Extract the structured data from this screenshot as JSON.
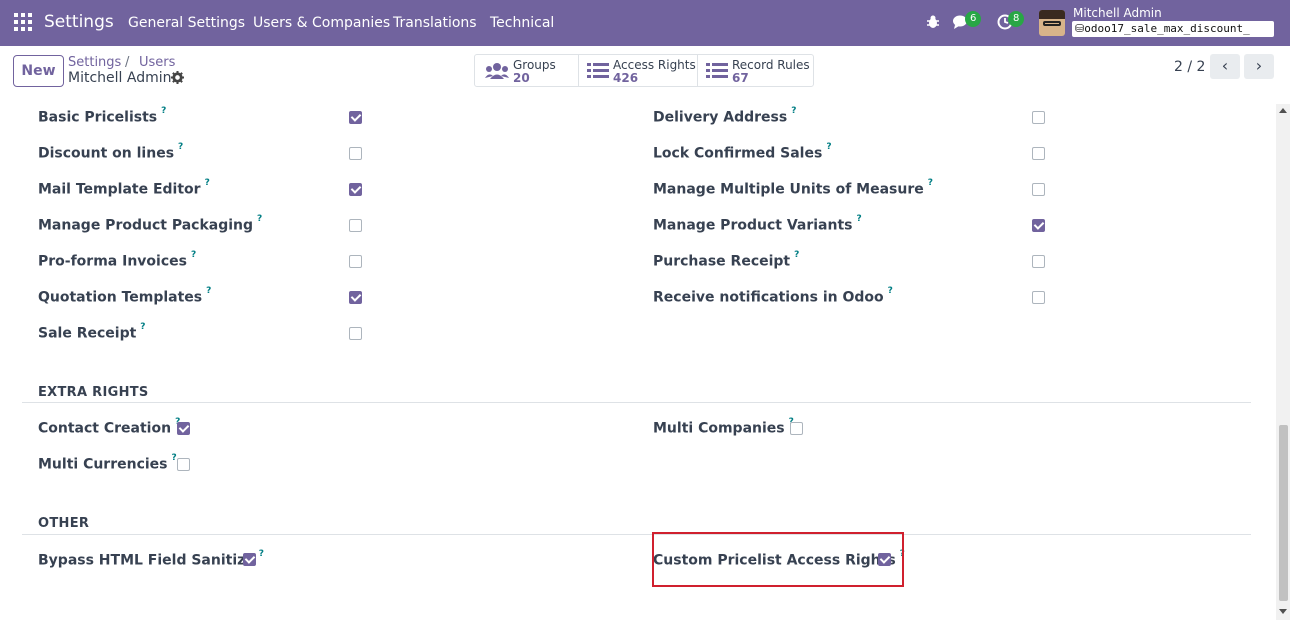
{
  "navbar": {
    "brand": "Settings",
    "menus": [
      "General Settings",
      "Users & Companies",
      "Translations",
      "Technical"
    ],
    "messages_count": "6",
    "activities_count": "8",
    "user_name": "Mitchell Admin",
    "database": "odoo17_sale_max_discount_"
  },
  "control": {
    "new_label": "New",
    "breadcrumb_settings": "Settings",
    "breadcrumb_sep": "/",
    "breadcrumb_users": "Users",
    "current_record": "Mitchell Admin",
    "stats": [
      {
        "label": "Groups",
        "count": "20"
      },
      {
        "label": "Access Rights",
        "count": "426"
      },
      {
        "label": "Record Rules",
        "count": "67"
      }
    ],
    "pager": "2 / 2",
    "prev": "‹",
    "next": "›"
  },
  "sales_rights": {
    "left": [
      {
        "label": "Basic Pricelists",
        "checked": true
      },
      {
        "label": "Discount on lines",
        "checked": false
      },
      {
        "label": "Mail Template Editor",
        "checked": true
      },
      {
        "label": "Manage Product Packaging",
        "checked": false
      },
      {
        "label": "Pro-forma Invoices",
        "checked": false
      },
      {
        "label": "Quotation Templates",
        "checked": true
      },
      {
        "label": "Sale Receipt",
        "checked": false
      }
    ],
    "right": [
      {
        "label": "Delivery Address",
        "checked": false
      },
      {
        "label": "Lock Confirmed Sales",
        "checked": false
      },
      {
        "label": "Manage Multiple Units of Measure",
        "checked": false
      },
      {
        "label": "Manage Product Variants",
        "checked": true
      },
      {
        "label": "Purchase Receipt",
        "checked": false
      },
      {
        "label": "Receive notifications in Odoo",
        "checked": false
      }
    ]
  },
  "extra_rights": {
    "title": "EXTRA RIGHTS",
    "contact_creation": {
      "label": "Contact Creation",
      "checked": true
    },
    "multi_currencies": {
      "label": "Multi Currencies",
      "checked": false
    },
    "multi_companies": {
      "label": "Multi Companies",
      "checked": false
    }
  },
  "other": {
    "title": "OTHER",
    "bypass_html": {
      "label": "Bypass HTML Field Sanitize",
      "checked": true
    },
    "custom_pricelist": {
      "label": "Custom Pricelist Access Rights",
      "checked": true
    }
  },
  "help_marker": "?",
  "colors": {
    "brand": "#71639e",
    "badge": "#28a745",
    "help": "#017e84",
    "highlight": "#d0202e"
  }
}
